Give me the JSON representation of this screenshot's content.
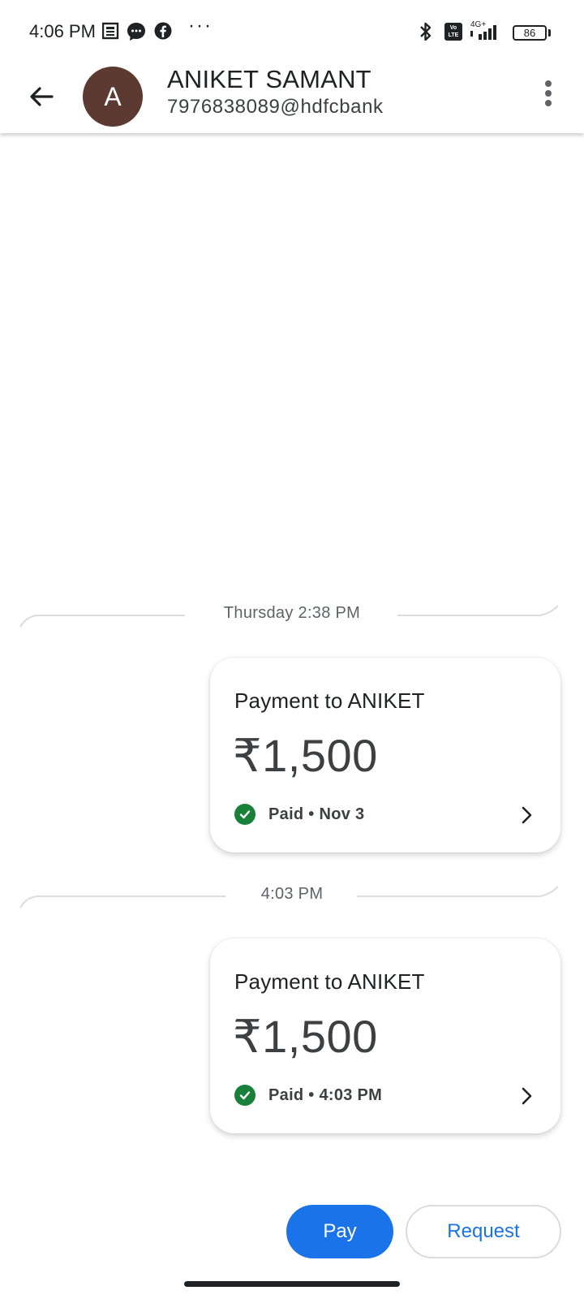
{
  "status_bar": {
    "time": "4:06 PM",
    "icons": [
      "news-icon",
      "messenger-icon",
      "facebook-icon",
      "more-notifications-icon",
      "bluetooth-icon",
      "volte-icon",
      "signal-icon",
      "battery-icon"
    ],
    "more_dots": "···",
    "volte_label": "Vo LTE",
    "network": "4G+",
    "battery": "86"
  },
  "header": {
    "avatar_letter": "A",
    "avatar_color": "#5d3a31",
    "contact_name": "ANIKET SAMANT",
    "contact_upi": "7976838089@hdfcbank",
    "back_icon": "arrow-back-icon",
    "menu_icon": "more-vert-icon"
  },
  "conversation": {
    "separators": [
      "Thursday 2:38 PM",
      "4:03 PM"
    ],
    "payments": [
      {
        "title": "Payment to ANIKET",
        "amount": "₹1,500",
        "status": "Paid • Nov 3"
      },
      {
        "title": "Payment to ANIKET",
        "amount": "₹1,500",
        "status": "Paid • 4:03 PM"
      }
    ]
  },
  "actions": {
    "pay_label": "Pay",
    "request_label": "Request"
  },
  "colors": {
    "accent": "#1a73e8",
    "success": "#188038",
    "avatar": "#5d3a31"
  }
}
